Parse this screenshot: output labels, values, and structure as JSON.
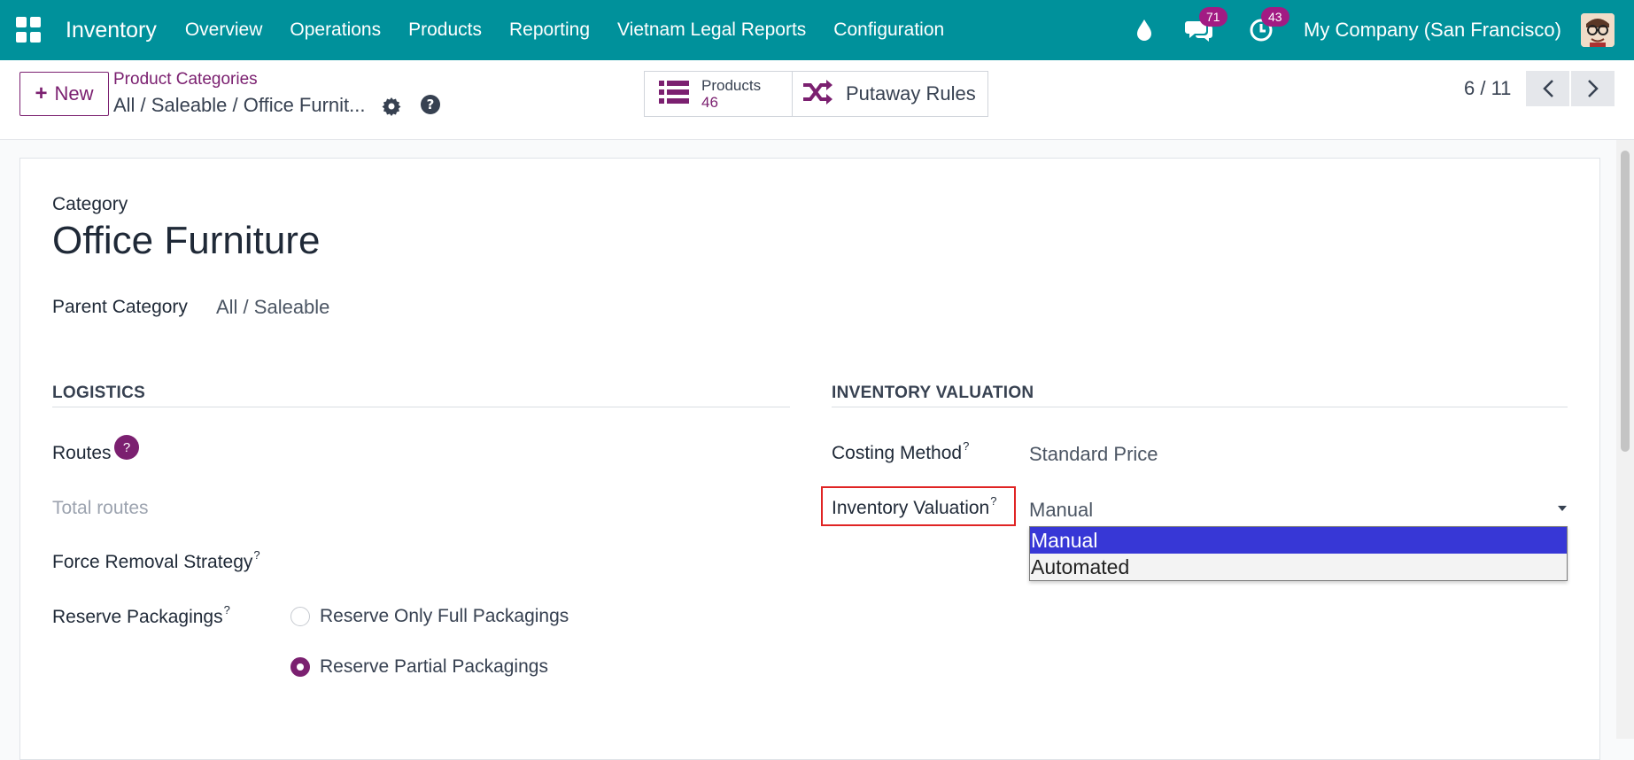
{
  "topbar": {
    "app_name": "Inventory",
    "menu": [
      "Overview",
      "Operations",
      "Products",
      "Reporting",
      "Vietnam Legal Reports",
      "Configuration"
    ],
    "messages_count": "71",
    "activities_count": "43",
    "company": "My Company (San Francisco)"
  },
  "control": {
    "new_label": "New",
    "breadcrumb_parent": "Product Categories",
    "breadcrumb_current": "All / Saleable / Office Furnit...",
    "smart_products_label": "Products",
    "smart_products_count": "46",
    "smart_putaway_label": "Putaway Rules",
    "pager": "6 / 11"
  },
  "form": {
    "category_label": "Category",
    "category_name": "Office Furniture",
    "parent_label": "Parent Category",
    "parent_value": "All / Saleable",
    "logistics_title": "LOGISTICS",
    "routes_label": "Routes",
    "routes_help": "?",
    "total_routes": "Total routes",
    "force_removal_label": "Force Removal Strategy",
    "reserve_label": "Reserve Packagings",
    "reserve_options": [
      "Reserve Only Full Packagings",
      "Reserve Partial Packagings"
    ],
    "valuation_title": "INVENTORY VALUATION",
    "costing_label": "Costing Method",
    "costing_value": "Standard Price",
    "inv_valuation_label": "Inventory Valuation",
    "inv_valuation_value": "Manual",
    "inv_valuation_options": [
      "Manual",
      "Automated"
    ],
    "tooltip_mark": "?"
  },
  "colors": {
    "topbar": "#00919b",
    "primary": "#7b2070",
    "highlight": "#e02424",
    "selected_option": "#3737d6"
  }
}
